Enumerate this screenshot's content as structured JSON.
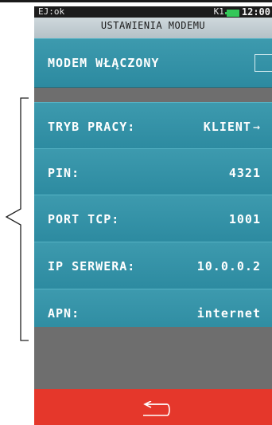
{
  "status_bar": {
    "left_text": "EJ:ok",
    "profile": "K1",
    "battery_color": "#34c759",
    "time": "12:00"
  },
  "title": "USTAWIENIA MODEMU",
  "modem_toggle": {
    "label": "MODEM WŁĄCZONY",
    "checked": false
  },
  "settings": [
    {
      "label": "TRYB PRACY:",
      "value": "KLIENT"
    },
    {
      "label": "PIN:",
      "value": "4321"
    },
    {
      "label": "PORT TCP:",
      "value": "1001"
    },
    {
      "label": "IP SERWERA:",
      "value": "10.0.0.2"
    },
    {
      "label": "APN:",
      "value": "internet"
    }
  ],
  "footer": {
    "back_icon": "back-arrow-icon",
    "color": "#e5372b"
  },
  "colors": {
    "row": "#3594a8",
    "title_bar": "#c3ced3",
    "background": "#6e6e6e"
  }
}
